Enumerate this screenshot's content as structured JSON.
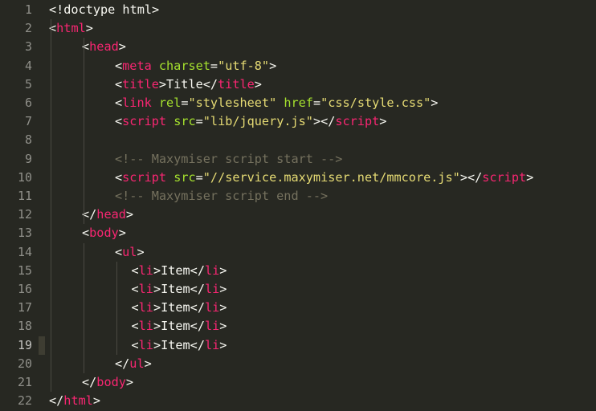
{
  "editor": {
    "theme": "monokai",
    "active_line": 19,
    "colors": {
      "background": "#272822",
      "tag": "#f92672",
      "attribute": "#a6e22e",
      "string": "#e6db74",
      "comment": "#75715e",
      "text": "#f8f8f2",
      "gutter_text": "#90908a"
    },
    "lines": [
      {
        "n": "1",
        "indent": 0,
        "tokens": [
          {
            "k": "p",
            "v": "<!doctype html>"
          }
        ]
      },
      {
        "n": "2",
        "indent": 0,
        "tokens": [
          {
            "k": "p",
            "v": "<"
          },
          {
            "k": "t",
            "v": "html"
          },
          {
            "k": "p",
            "v": ">"
          }
        ]
      },
      {
        "n": "3",
        "indent": 1,
        "tokens": [
          {
            "k": "p",
            "v": "<"
          },
          {
            "k": "t",
            "v": "head"
          },
          {
            "k": "p",
            "v": ">"
          }
        ]
      },
      {
        "n": "4",
        "indent": 2,
        "tokens": [
          {
            "k": "p",
            "v": "<"
          },
          {
            "k": "t",
            "v": "meta"
          },
          {
            "k": "p",
            "v": " "
          },
          {
            "k": "a",
            "v": "charset"
          },
          {
            "k": "p",
            "v": "="
          },
          {
            "k": "s",
            "v": "\"utf-8\""
          },
          {
            "k": "p",
            "v": ">"
          }
        ]
      },
      {
        "n": "5",
        "indent": 2,
        "tokens": [
          {
            "k": "p",
            "v": "<"
          },
          {
            "k": "t",
            "v": "title"
          },
          {
            "k": "p",
            "v": ">Title</"
          },
          {
            "k": "t",
            "v": "title"
          },
          {
            "k": "p",
            "v": ">"
          }
        ]
      },
      {
        "n": "6",
        "indent": 2,
        "tokens": [
          {
            "k": "p",
            "v": "<"
          },
          {
            "k": "t",
            "v": "link"
          },
          {
            "k": "p",
            "v": " "
          },
          {
            "k": "a",
            "v": "rel"
          },
          {
            "k": "p",
            "v": "="
          },
          {
            "k": "s",
            "v": "\"stylesheet\""
          },
          {
            "k": "p",
            "v": " "
          },
          {
            "k": "a",
            "v": "href"
          },
          {
            "k": "p",
            "v": "="
          },
          {
            "k": "s",
            "v": "\"css/style.css\""
          },
          {
            "k": "p",
            "v": ">"
          }
        ]
      },
      {
        "n": "7",
        "indent": 2,
        "tokens": [
          {
            "k": "p",
            "v": "<"
          },
          {
            "k": "t",
            "v": "script"
          },
          {
            "k": "p",
            "v": " "
          },
          {
            "k": "a",
            "v": "src"
          },
          {
            "k": "p",
            "v": "="
          },
          {
            "k": "s",
            "v": "\"lib/jquery.js\""
          },
          {
            "k": "p",
            "v": "></"
          },
          {
            "k": "t",
            "v": "script"
          },
          {
            "k": "p",
            "v": ">"
          }
        ]
      },
      {
        "n": "8",
        "indent": 2,
        "tokens": []
      },
      {
        "n": "9",
        "indent": 2,
        "tokens": [
          {
            "k": "c",
            "v": "<!-- Maxymiser script start -->"
          }
        ]
      },
      {
        "n": "10",
        "indent": 2,
        "tokens": [
          {
            "k": "p",
            "v": "<"
          },
          {
            "k": "t",
            "v": "script"
          },
          {
            "k": "p",
            "v": " "
          },
          {
            "k": "a",
            "v": "src"
          },
          {
            "k": "p",
            "v": "="
          },
          {
            "k": "s",
            "v": "\"//service.maxymiser.net/mmcore.js\""
          },
          {
            "k": "p",
            "v": "></"
          },
          {
            "k": "t",
            "v": "script"
          },
          {
            "k": "p",
            "v": ">"
          }
        ]
      },
      {
        "n": "11",
        "indent": 2,
        "tokens": [
          {
            "k": "c",
            "v": "<!-- Maxymiser script end -->"
          }
        ]
      },
      {
        "n": "12",
        "indent": 1,
        "tokens": [
          {
            "k": "p",
            "v": "</"
          },
          {
            "k": "t",
            "v": "head"
          },
          {
            "k": "p",
            "v": ">"
          }
        ]
      },
      {
        "n": "13",
        "indent": 1,
        "tokens": [
          {
            "k": "p",
            "v": "<"
          },
          {
            "k": "t",
            "v": "body"
          },
          {
            "k": "p",
            "v": ">"
          }
        ]
      },
      {
        "n": "14",
        "indent": 2,
        "tokens": [
          {
            "k": "p",
            "v": "<"
          },
          {
            "k": "t",
            "v": "ul"
          },
          {
            "k": "p",
            "v": ">"
          }
        ]
      },
      {
        "n": "15",
        "indent": 2.5,
        "tokens": [
          {
            "k": "p",
            "v": "<"
          },
          {
            "k": "t",
            "v": "li"
          },
          {
            "k": "p",
            "v": ">Item</"
          },
          {
            "k": "t",
            "v": "li"
          },
          {
            "k": "p",
            "v": ">"
          }
        ]
      },
      {
        "n": "16",
        "indent": 2.5,
        "tokens": [
          {
            "k": "p",
            "v": "<"
          },
          {
            "k": "t",
            "v": "li"
          },
          {
            "k": "p",
            "v": ">Item</"
          },
          {
            "k": "t",
            "v": "li"
          },
          {
            "k": "p",
            "v": ">"
          }
        ]
      },
      {
        "n": "17",
        "indent": 2.5,
        "tokens": [
          {
            "k": "p",
            "v": "<"
          },
          {
            "k": "t",
            "v": "li"
          },
          {
            "k": "p",
            "v": ">Item</"
          },
          {
            "k": "t",
            "v": "li"
          },
          {
            "k": "p",
            "v": ">"
          }
        ]
      },
      {
        "n": "18",
        "indent": 2.5,
        "tokens": [
          {
            "k": "p",
            "v": "<"
          },
          {
            "k": "t",
            "v": "li"
          },
          {
            "k": "p",
            "v": ">Item</"
          },
          {
            "k": "t",
            "v": "li"
          },
          {
            "k": "p",
            "v": ">"
          }
        ]
      },
      {
        "n": "19",
        "indent": 2.5,
        "tokens": [
          {
            "k": "p",
            "v": "<"
          },
          {
            "k": "t",
            "v": "li"
          },
          {
            "k": "p",
            "v": ">Item</"
          },
          {
            "k": "t",
            "v": "li"
          },
          {
            "k": "p",
            "v": ">"
          }
        ]
      },
      {
        "n": "20",
        "indent": 2,
        "tokens": [
          {
            "k": "p",
            "v": "</"
          },
          {
            "k": "t",
            "v": "ul"
          },
          {
            "k": "p",
            "v": ">"
          }
        ]
      },
      {
        "n": "21",
        "indent": 1,
        "tokens": [
          {
            "k": "p",
            "v": "</"
          },
          {
            "k": "t",
            "v": "body"
          },
          {
            "k": "p",
            "v": ">"
          }
        ]
      },
      {
        "n": "22",
        "indent": 0,
        "tokens": [
          {
            "k": "p",
            "v": "</"
          },
          {
            "k": "t",
            "v": "html"
          },
          {
            "k": "p",
            "v": ">"
          }
        ]
      }
    ]
  }
}
